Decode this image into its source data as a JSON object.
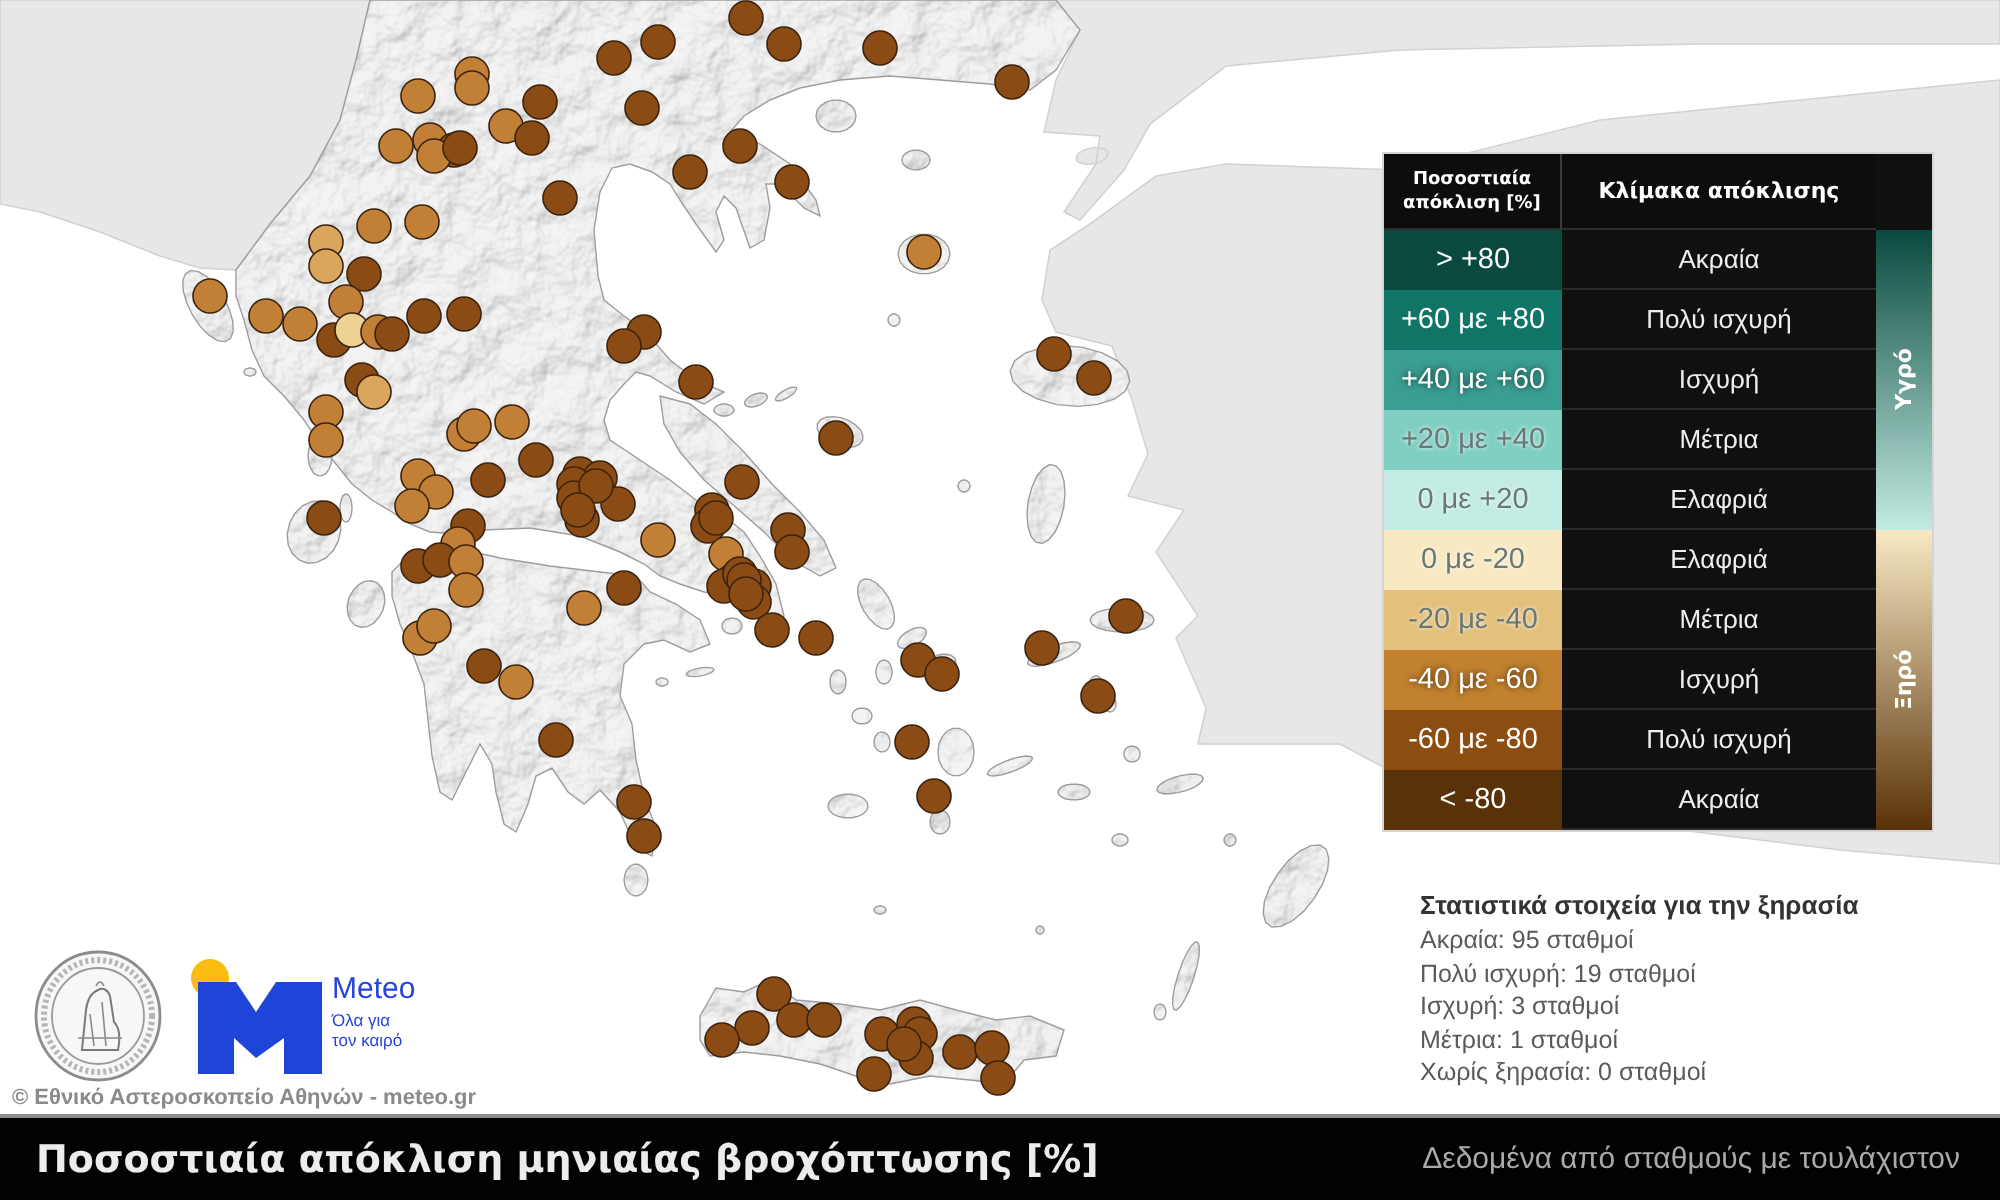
{
  "map": {
    "stations": [
      {
        "color": "#8b4b14"
      },
      {
        "color": "#8b4b14"
      },
      {
        "color": "#8b4b14"
      },
      {
        "color": "#8b4b14"
      },
      {
        "color": "#8b4b14"
      },
      {
        "color": "#c27f36"
      },
      {
        "color": "#c27f36"
      },
      {
        "color": "#c27f36"
      },
      {
        "color": "#8b4b14"
      },
      {
        "color": "#8b4b14"
      },
      {
        "color": "#c27f36"
      },
      {
        "color": "#8b4b14"
      },
      {
        "color": "#c27f36"
      },
      {
        "color": "#c27f36"
      },
      {
        "color": "#8b4b14"
      },
      {
        "color": "#c27f36"
      },
      {
        "color": "#8b4b14"
      },
      {
        "color": "#8b4b14"
      },
      {
        "color": "#8b4b14"
      },
      {
        "color": "#8b4b14"
      },
      {
        "color": "#c27f36"
      },
      {
        "color": "#c27f36"
      },
      {
        "color": "#d9a65b"
      },
      {
        "color": "#d9a65b"
      },
      {
        "color": "#8b4b14"
      },
      {
        "color": "#c27f36"
      },
      {
        "color": "#c27f36"
      },
      {
        "color": "#c27f36"
      },
      {
        "color": "#c27f36"
      },
      {
        "color": "#c27f36"
      },
      {
        "color": "#8b4b14"
      },
      {
        "color": "#edd293"
      },
      {
        "color": "#c27f36"
      },
      {
        "color": "#8b4b14"
      },
      {
        "color": "#8b4b14"
      },
      {
        "color": "#8b4b14"
      },
      {
        "color": "#8b4b14"
      },
      {
        "color": "#8b4b14"
      },
      {
        "color": "#8b4b14"
      },
      {
        "color": "#8b4b14"
      },
      {
        "color": "#d9a65b"
      },
      {
        "color": "#c27f36"
      },
      {
        "color": "#c27f36"
      },
      {
        "color": "#8b4b14"
      },
      {
        "color": "#8b4b14"
      },
      {
        "color": "#8b4b14"
      },
      {
        "color": "#c27f36"
      },
      {
        "color": "#c27f36"
      },
      {
        "color": "#c27f36"
      },
      {
        "color": "#8b4b14"
      },
      {
        "color": "#c27f36"
      },
      {
        "color": "#c27f36"
      },
      {
        "color": "#c27f36"
      },
      {
        "color": "#8b4b14"
      },
      {
        "color": "#8b4b14"
      },
      {
        "color": "#8b4b14"
      },
      {
        "color": "#8b4b14"
      },
      {
        "color": "#8b4b14"
      },
      {
        "color": "#8b4b14"
      },
      {
        "color": "#8b4b14"
      },
      {
        "color": "#8b4b14"
      },
      {
        "color": "#8b4b14"
      },
      {
        "color": "#8b4b14"
      },
      {
        "color": "#8b4b14"
      },
      {
        "color": "#8b4b14"
      },
      {
        "color": "#8b4b14"
      },
      {
        "color": "#c27f36"
      },
      {
        "color": "#8b4b14"
      },
      {
        "color": "#c27f36"
      },
      {
        "color": "#8b4b14"
      },
      {
        "color": "#8b4b14"
      },
      {
        "color": "#c27f36"
      },
      {
        "color": "#c27f36"
      },
      {
        "color": "#c27f36"
      },
      {
        "color": "#8b4b14"
      },
      {
        "color": "#8b4b14"
      },
      {
        "color": "#8b4b14"
      },
      {
        "color": "#8b4b14"
      },
      {
        "color": "#8b4b14"
      },
      {
        "color": "#c27f36"
      },
      {
        "color": "#8b4b14"
      },
      {
        "color": "#8b4b14"
      },
      {
        "color": "#8b4b14"
      },
      {
        "color": "#8b4b14"
      },
      {
        "color": "#8b4b14"
      },
      {
        "color": "#8b4b14"
      },
      {
        "color": "#c27f36"
      },
      {
        "color": "#c27f36"
      },
      {
        "color": "#8b4b14"
      },
      {
        "color": "#c27f36"
      },
      {
        "color": "#8b4b14"
      },
      {
        "color": "#8b4b14"
      },
      {
        "color": "#8b4b14"
      },
      {
        "color": "#8b4b14"
      },
      {
        "color": "#8b4b14"
      },
      {
        "color": "#8b4b14"
      },
      {
        "color": "#8b4b14"
      },
      {
        "color": "#8b4b14"
      },
      {
        "color": "#8b4b14"
      },
      {
        "color": "#8b4b14"
      },
      {
        "color": "#8b4b14"
      },
      {
        "color": "#8b4b14"
      },
      {
        "color": "#8b4b14"
      },
      {
        "color": "#8b4b14"
      },
      {
        "color": "#8b4b14"
      },
      {
        "color": "#8b4b14"
      },
      {
        "color": "#8b4b14"
      },
      {
        "color": "#8b4b14"
      },
      {
        "color": "#8b4b14"
      },
      {
        "color": "#8b4b14"
      },
      {
        "color": "#8b4b14"
      },
      {
        "color": "#8b4b14"
      },
      {
        "color": "#8b4b14"
      },
      {
        "color": "#8b4b14"
      },
      {
        "color": "#8b4b14"
      },
      {
        "color": "#8b4b14"
      },
      {
        "color": "#8b4b14"
      },
      {
        "color": "#8b4b14"
      }
    ]
  },
  "legend": {
    "columns": [
      "Ποσοστιαία απόκλιση [%]",
      "Κλίμακα απόκλισης"
    ],
    "groups": [
      {
        "label": "Υγρό",
        "rows": [
          {
            "range": "> +80",
            "intensity": "Ακραία",
            "color": "#0a4a3e"
          },
          {
            "range": "+60 με +80",
            "intensity": "Πολύ ισχυρή",
            "color": "#107466"
          },
          {
            "range": "+40 με +60",
            "intensity": "Ισχυρή",
            "color": "#3a9e92"
          },
          {
            "range": "+20 με +40",
            "intensity": "Μέτρια",
            "color": "#80cfc3"
          },
          {
            "range": "0 με +20",
            "intensity": "Ελαφριά",
            "color": "#c2ebe3"
          }
        ]
      },
      {
        "label": "Ξηρό",
        "rows": [
          {
            "range": "0 με -20",
            "intensity": "Ελαφριά",
            "color": "#f8e9c3"
          },
          {
            "range": "-20 με -40",
            "intensity": "Μέτρια",
            "color": "#e3c07b"
          },
          {
            "range": "-40 με -60",
            "intensity": "Ισχυρή",
            "color": "#c1812f"
          },
          {
            "range": "-60 με -80",
            "intensity": "Πολύ ισχυρή",
            "color": "#8c4e10"
          },
          {
            "range": "< -80",
            "intensity": "Ακραία",
            "color": "#5a3209"
          }
        ]
      }
    ]
  },
  "statistics": {
    "title": "Στατιστικά στοιχεία για την ξηρασία",
    "lines": [
      "Ακραία: 95 σταθμοί",
      "Πολύ ισχυρή: 19 σταθμοί",
      "Ισχυρή: 3 σταθμοί",
      "Μέτρια: 1 σταθμοί",
      "Χωρίς ξηρασία: 0 σταθμοί"
    ]
  },
  "credits": {
    "brand": "Meteo",
    "tagline": [
      "Όλα για",
      "τον καιρό"
    ],
    "copyright": "© Εθνικό Αστεροσκοπείο Αθηνών - meteo.gr"
  },
  "caption": {
    "title": "Ποσοστιαία απόκλιση μηνιαίας βροχόπτωσης [%]",
    "note": "Δεδομένα από σταθμούς με τουλάχιστον"
  }
}
